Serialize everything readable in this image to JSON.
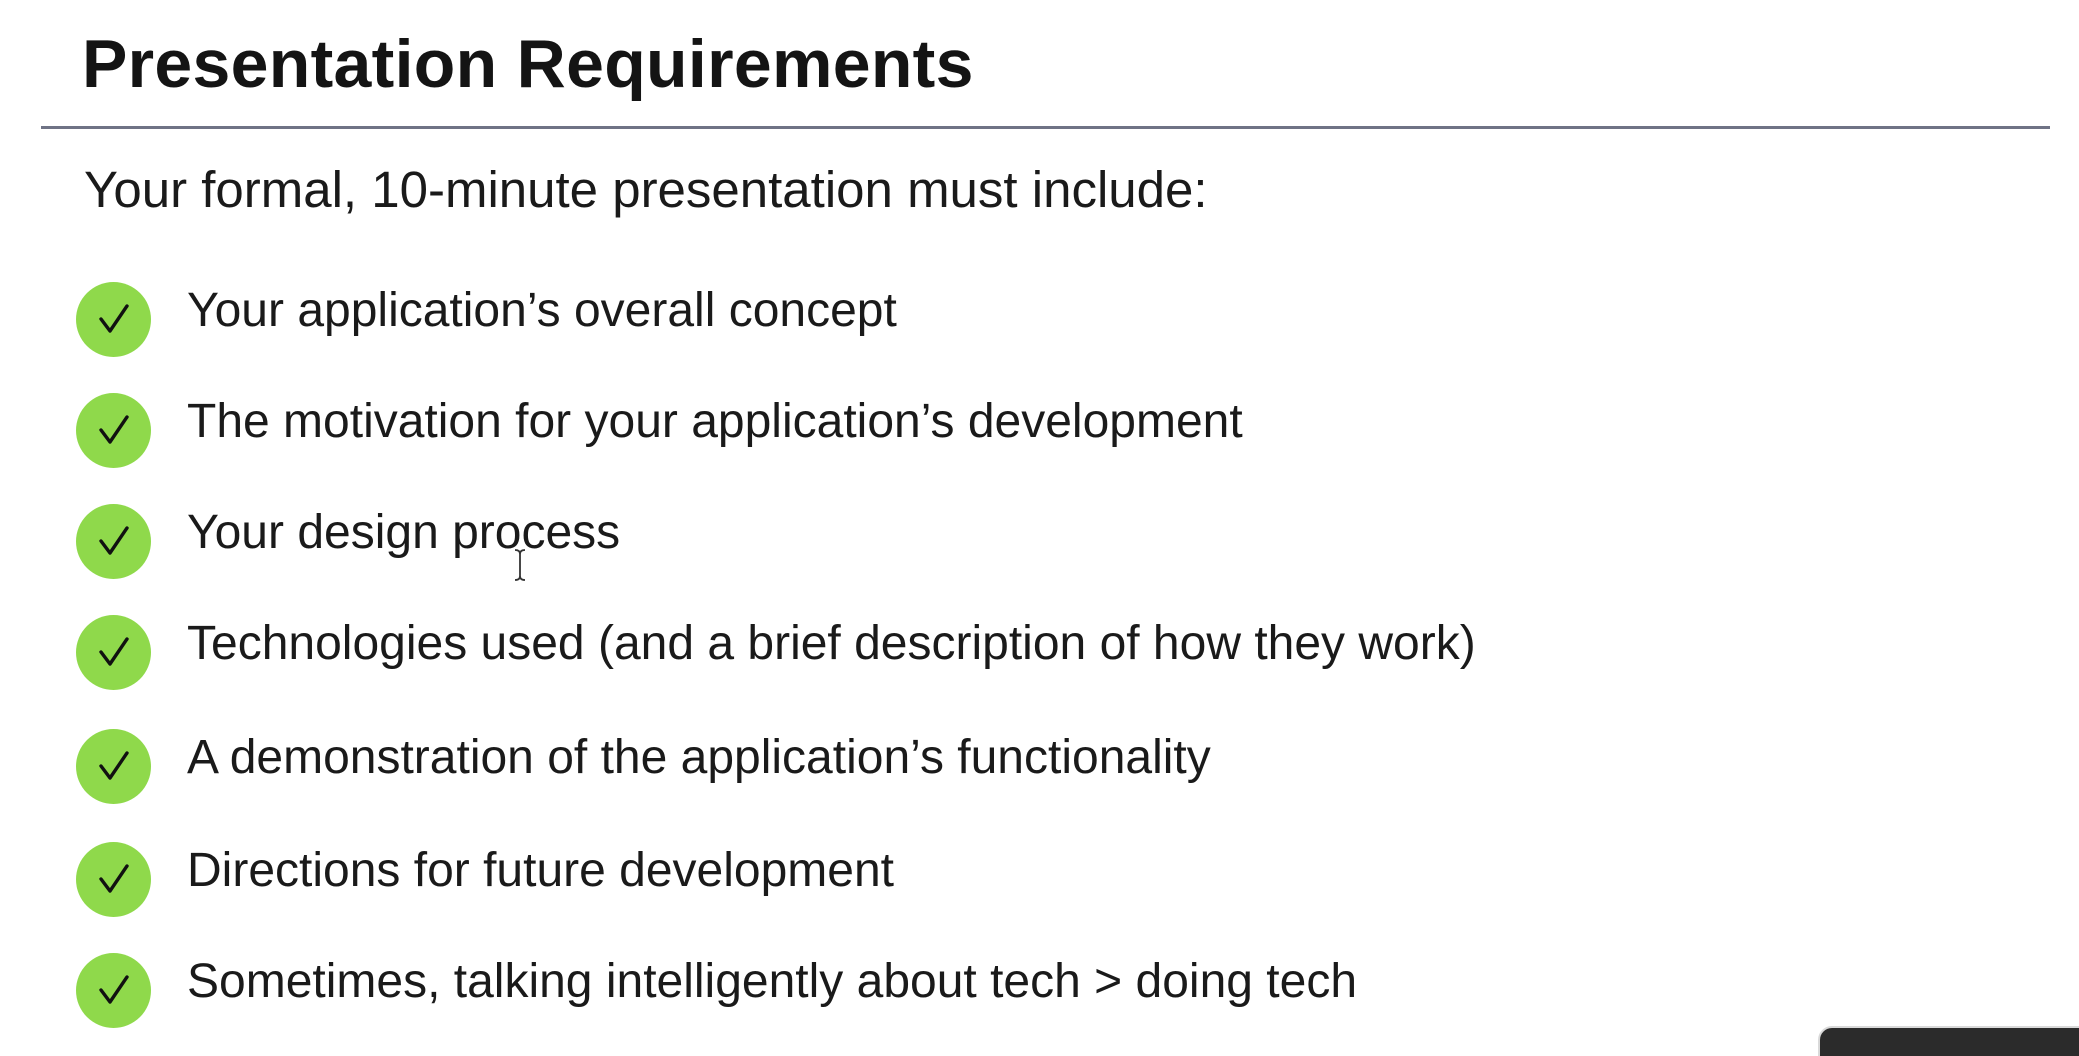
{
  "slide": {
    "title": "Presentation Requirements",
    "intro": "Your formal, 10-minute presentation must include:",
    "items": [
      {
        "label": "Your application’s overall concept"
      },
      {
        "label": "The motivation for your application’s development"
      },
      {
        "label": "Your design process"
      },
      {
        "label": "Technologies used (and a brief description of how they work)"
      },
      {
        "label": "A demonstration of the application’s functionality"
      },
      {
        "label": "Directions for future development"
      },
      {
        "label": "Sometimes, talking intelligently about tech > doing tech"
      }
    ],
    "bullet_icon": "check-circle-icon"
  },
  "colors": {
    "check_fill": "#8fd94b",
    "rule": "#6f7385",
    "text": "#1a1a1a"
  }
}
